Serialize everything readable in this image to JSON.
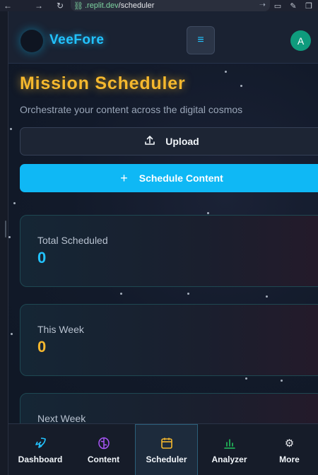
{
  "browser": {
    "url_host": ".replit.dev",
    "url_path": "/scheduler"
  },
  "header": {
    "brand": "VeeFore",
    "avatar_letter": "A"
  },
  "page": {
    "title": "Mission Scheduler",
    "subtitle": "Orchestrate your content across the digital cosmos"
  },
  "actions": {
    "upload_label": "Upload",
    "schedule_label": "Schedule Content"
  },
  "stats": [
    {
      "label": "Total Scheduled",
      "value": "0",
      "color": "#22c3ff"
    },
    {
      "label": "This Week",
      "value": "0",
      "color": "#f5b82e"
    },
    {
      "label": "Next Week",
      "value": ""
    }
  ],
  "bottom_nav": [
    {
      "label": "Dashboard",
      "icon": "rocket-icon",
      "color": "#22c3ff"
    },
    {
      "label": "Content",
      "icon": "brain-icon",
      "color": "#a855f7"
    },
    {
      "label": "Scheduler",
      "icon": "calendar-icon",
      "color": "#f5b82e",
      "active": true
    },
    {
      "label": "Analyzer",
      "icon": "bar-chart-icon",
      "color": "#22c55e"
    },
    {
      "label": "More",
      "icon": "gear-icon",
      "color": "#e5e7eb"
    }
  ]
}
